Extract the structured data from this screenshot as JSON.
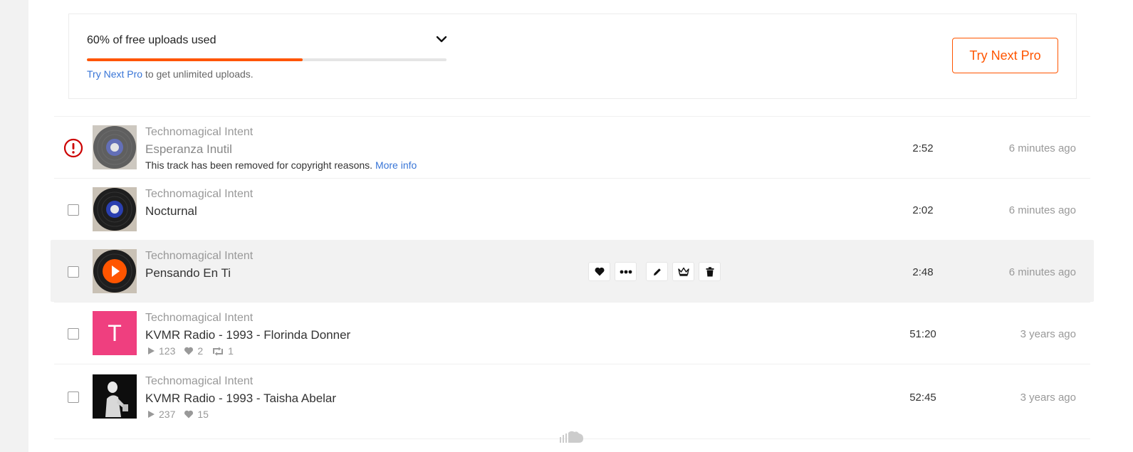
{
  "banner": {
    "title": "60% of free uploads used",
    "progress_percent": 60,
    "sub_link": "Try Next Pro",
    "sub_text": " to get unlimited uploads.",
    "cta_label": "Try Next Pro",
    "icons": [
      "chevron-down-icon"
    ]
  },
  "colors": {
    "accent": "#ff5500",
    "link": "#3875d7",
    "warning": "#cc0000",
    "letter_art": "#ef3f7f"
  },
  "tracks": [
    {
      "artist": "Technomagical Intent",
      "title": "Esperanza Inutil",
      "notice": "This track has been removed for copyright reasons.",
      "notice_link": "More info",
      "duration": "2:52",
      "ago": "6 minutes ago",
      "status": "warning-icon"
    },
    {
      "artist": "Technomagical Intent",
      "title": "Nocturnal",
      "duration": "2:02",
      "ago": "6 minutes ago"
    },
    {
      "artist": "Technomagical Intent",
      "title": "Pensando En Ti",
      "duration": "2:48",
      "ago": "6 minutes ago",
      "hovered": true,
      "action_icons": [
        "heart-icon",
        "more-icon",
        "edit-pencil-icon",
        "crown-icon",
        "trash-icon"
      ]
    },
    {
      "artist": "Technomagical Intent",
      "title": "KVMR Radio - 1993 - Florinda Donner",
      "art_letter": "T",
      "plays": "123",
      "likes": "2",
      "reposts": "1",
      "duration": "51:20",
      "ago": "3 years ago"
    },
    {
      "artist": "Technomagical Intent",
      "title": "KVMR Radio - 1993 - Taisha Abelar",
      "plays": "237",
      "likes": "15",
      "duration": "52:45",
      "ago": "3 years ago"
    }
  ]
}
